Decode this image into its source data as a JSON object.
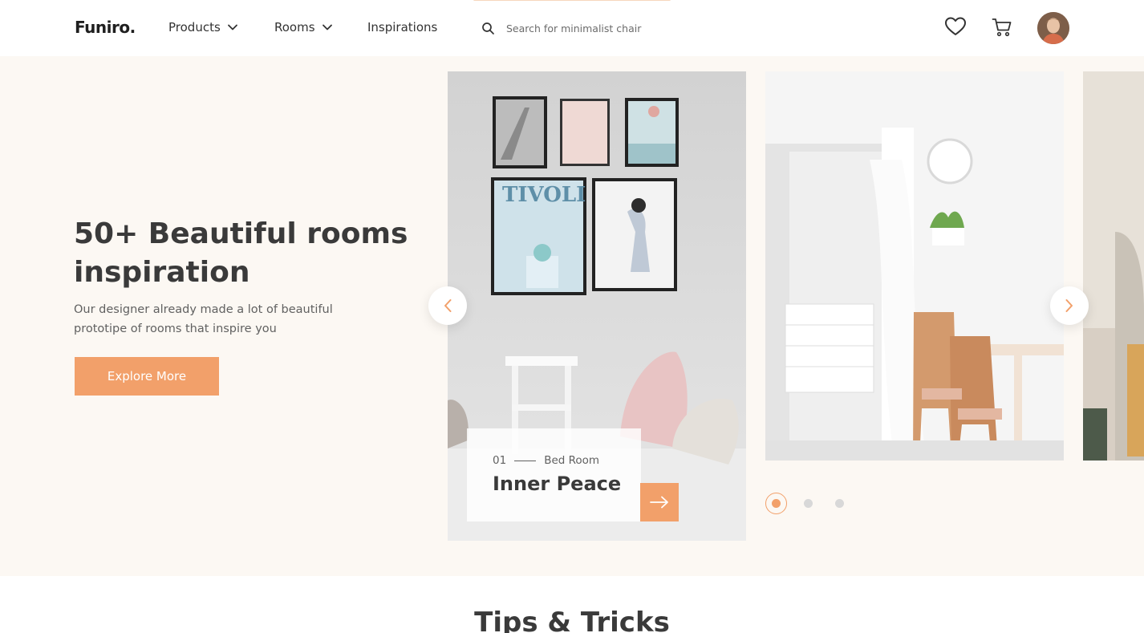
{
  "brand": {
    "logo": "Funiro.",
    "accent_color": "#f2a06a",
    "hero_bg": "#fcf8f3"
  },
  "nav": {
    "items": [
      {
        "label": "Products",
        "has_dropdown": true
      },
      {
        "label": "Rooms",
        "has_dropdown": true
      },
      {
        "label": "Inspirations",
        "has_dropdown": false
      }
    ]
  },
  "search": {
    "placeholder": "Search for minimalist chair",
    "value": "",
    "icon": "search-icon"
  },
  "header_icons": [
    "heart-icon",
    "cart-icon"
  ],
  "hero": {
    "title": "50+ Beautiful rooms inspiration",
    "subtitle": "Our designer already made a lot of beautiful prototipe of rooms that inspire you",
    "cta_label": "Explore More"
  },
  "slider": {
    "active_slide": {
      "number": "01",
      "category": "Bed Room",
      "title": "Inner Peace"
    },
    "dots": {
      "count": 3,
      "active_index": 0
    }
  },
  "section": {
    "title": "Tips & Tricks"
  }
}
